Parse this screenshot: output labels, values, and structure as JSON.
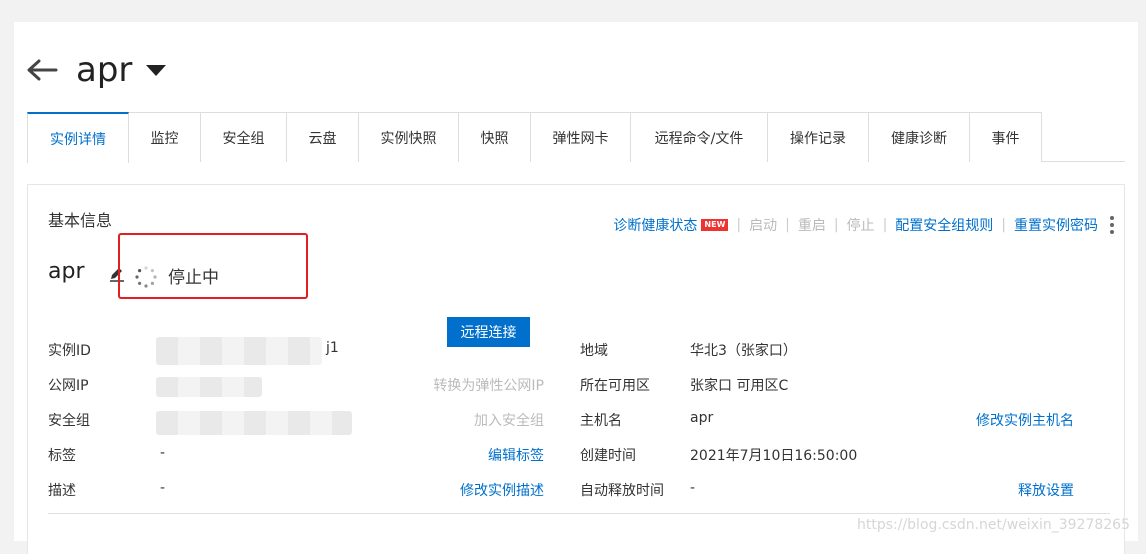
{
  "header": {
    "title": "apr"
  },
  "tabs": [
    {
      "label": "实例详情",
      "active": true
    },
    {
      "label": "监控"
    },
    {
      "label": "安全组"
    },
    {
      "label": "云盘"
    },
    {
      "label": "实例快照"
    },
    {
      "label": "快照"
    },
    {
      "label": "弹性网卡"
    },
    {
      "label": "远程命令/文件"
    },
    {
      "label": "操作记录"
    },
    {
      "label": "健康诊断"
    },
    {
      "label": "事件"
    }
  ],
  "section": {
    "title": "基本信息",
    "actions": {
      "diagnose": "诊断健康状态",
      "new_badge": "NEW",
      "start": "启动",
      "restart": "重启",
      "stop": "停止",
      "config_sg": "配置安全组规则",
      "reset_pwd": "重置实例密码"
    }
  },
  "instance": {
    "name": "apr",
    "status": "停止中"
  },
  "left_fields": {
    "instance_id": {
      "label": "实例ID",
      "value_suffix": "j1",
      "action": "远程连接"
    },
    "public_ip": {
      "label": "公网IP",
      "action": "转换为弹性公网IP"
    },
    "security_group": {
      "label": "安全组",
      "action": "加入安全组"
    },
    "tags": {
      "label": "标签",
      "value": "-",
      "action": "编辑标签"
    },
    "description": {
      "label": "描述",
      "value": "-",
      "action": "修改实例描述"
    }
  },
  "right_fields": {
    "region": {
      "label": "地域",
      "value": "华北3（张家口）"
    },
    "zone": {
      "label": "所在可用区",
      "value": "张家口 可用区C"
    },
    "hostname": {
      "label": "主机名",
      "value": "apr",
      "action": "修改实例主机名"
    },
    "created": {
      "label": "创建时间",
      "value": "2021年7月10日16:50:00"
    },
    "auto_release": {
      "label": "自动释放时间",
      "value": "-",
      "action": "释放设置"
    }
  },
  "watermark": "https://blog.csdn.net/weixin_39278265",
  "colors": {
    "accent": "#0070cc",
    "highlight_box": "#e02020",
    "badge": "#e33333"
  }
}
